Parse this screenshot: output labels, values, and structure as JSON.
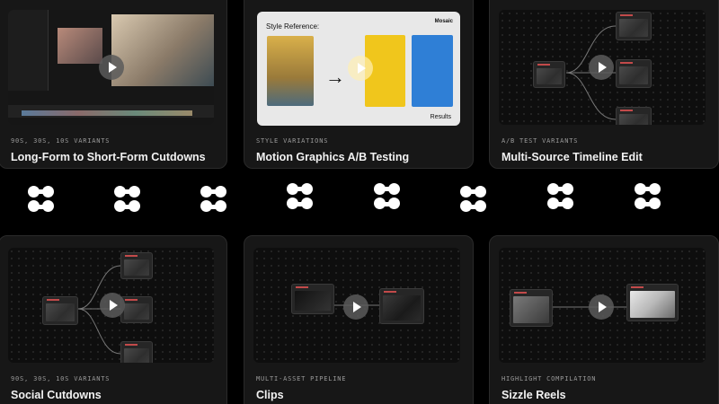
{
  "cards": [
    {
      "kicker": "90S, 30S, 10S VARIANTS",
      "title": "Long-Form to Short-Form Cutdowns"
    },
    {
      "kicker": "STYLE VARIATIONS",
      "title": "Motion Graphics A/B Testing"
    },
    {
      "kicker": "A/B TEST VARIANTS",
      "title": "Multi-Source Timeline Edit"
    },
    {
      "kicker": "90S, 30S, 10S VARIANTS",
      "title": "Social Cutdowns"
    },
    {
      "kicker": "MULTI-ASSET PIPELINE",
      "title": "Clips"
    },
    {
      "kicker": "HIGHLIGHT COMPILATION",
      "title": "Sizzle Reels"
    }
  ],
  "style_reference": {
    "label": "Style Reference:",
    "brand": "Mosaic",
    "results": "Results"
  },
  "logo_count": 8,
  "icons": [
    "play-icon",
    "mosaic-logo-icon",
    "arrow-right-icon"
  ]
}
